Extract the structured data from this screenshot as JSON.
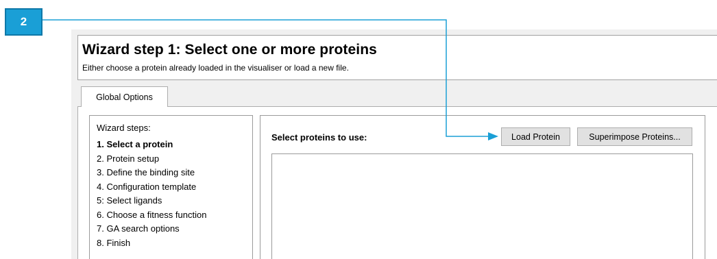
{
  "callout": {
    "number": "2"
  },
  "header": {
    "title": "Wizard step 1: Select one or more proteins",
    "subtitle": "Either choose a protein already loaded in the visualiser or load a new file."
  },
  "tabs": [
    {
      "label": "Global Options"
    }
  ],
  "wizard_steps": {
    "title": "Wizard steps:",
    "items": [
      {
        "label": "1. Select a protein",
        "active": true
      },
      {
        "label": "2. Protein setup"
      },
      {
        "label": "3. Define the binding site"
      },
      {
        "label": "4. Configuration template"
      },
      {
        "label": "5: Select ligands"
      },
      {
        "label": "6. Choose a fitness function"
      },
      {
        "label": "7. GA search options"
      },
      {
        "label": "8. Finish"
      }
    ]
  },
  "main": {
    "select_label": "Select proteins to use:",
    "load_button": "Load Protein",
    "superimpose_button": "Superimpose Proteins..."
  },
  "colors": {
    "callout": "#1a9fd6"
  }
}
